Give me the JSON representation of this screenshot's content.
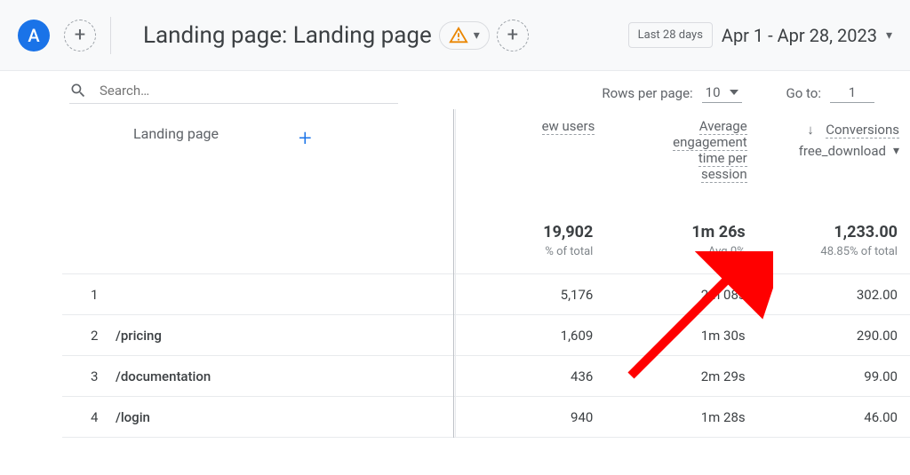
{
  "header": {
    "avatar_letter": "A",
    "title": "Landing page: Landing page",
    "date_label": "Last 28 days",
    "date_range": "Apr 1 - Apr 28, 2023"
  },
  "controls": {
    "search_placeholder": "Search…",
    "rows_label": "Rows per page:",
    "rows_value": "10",
    "goto_label": "Go to:",
    "goto_value": "1"
  },
  "columns": {
    "dimension": "Landing page",
    "metric1": "ew users",
    "metric2_l1": "Average",
    "metric2_l2": "engagement",
    "metric2_l3": "time per",
    "metric2_l4": "session",
    "metric3": "Conversions",
    "metric3_sub": "free_download"
  },
  "summary": {
    "users": "19,902",
    "users_sub": "% of total",
    "engage": "1m 26s",
    "engage_sub": "Avg 0%",
    "conv": "1,233.00",
    "conv_sub": "48.85% of total"
  },
  "rows": [
    {
      "idx": "1",
      "page": "",
      "users": "5,176",
      "engage": "2m 08s",
      "conv": "302.00"
    },
    {
      "idx": "2",
      "page": "/pricing",
      "users": "1,609",
      "engage": "1m 30s",
      "conv": "290.00"
    },
    {
      "idx": "3",
      "page": "/documentation",
      "users": "436",
      "engage": "2m 29s",
      "conv": "99.00"
    },
    {
      "idx": "4",
      "page": "/login",
      "users": "940",
      "engage": "1m 28s",
      "conv": "46.00"
    }
  ]
}
